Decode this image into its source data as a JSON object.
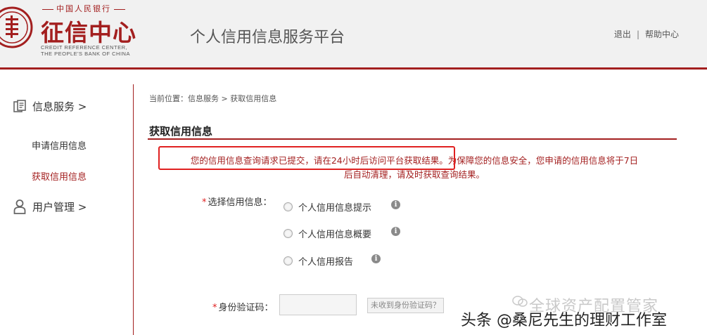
{
  "logo": {
    "top_text": "中国人民银行",
    "main_text": "征信中心",
    "en_line1": "CREDIT REFERENCE CENTER,",
    "en_line2": "THE PEOPLE'S BANK OF CHINA"
  },
  "header": {
    "platform_title": "个人信用信息服务平台",
    "logout": "退出",
    "separator": "|",
    "help": "帮助中心"
  },
  "sidebar": {
    "groups": [
      {
        "label": "信息服务 >",
        "icon": "document-icon"
      },
      {
        "label": "用户管理 >",
        "icon": "user-icon"
      }
    ],
    "items": [
      {
        "label": "申请信用信息",
        "active": false
      },
      {
        "label": "获取信用信息",
        "active": true
      }
    ]
  },
  "main": {
    "breadcrumb": "当前位置：信息服务 > 获取信用信息",
    "section_title": "获取信用信息",
    "notice_line1": "您的信用信息查询请求已提交，请在24小时后访问平台获取结果。为保障您的信息安全，您申请的信用信息将于7日",
    "notice_line2": "后自动清理，请及时获取查询结果。",
    "select_label_required": "*",
    "select_label": "选择信用信息：",
    "options": [
      {
        "label": "个人信用信息提示"
      },
      {
        "label": "个人信用信息概要"
      },
      {
        "label": "个人信用报告"
      }
    ],
    "code_label_required": "*",
    "code_label": "身份验证码：",
    "code_value": "",
    "code_button": "未收到身份验证码？"
  },
  "watermark": {
    "line1": "全球资产配置管家",
    "line2": "头条 @桑尼先生的理财工作室"
  },
  "colors": {
    "brand_red": "#a31f1f",
    "highlight": "#e02020"
  }
}
